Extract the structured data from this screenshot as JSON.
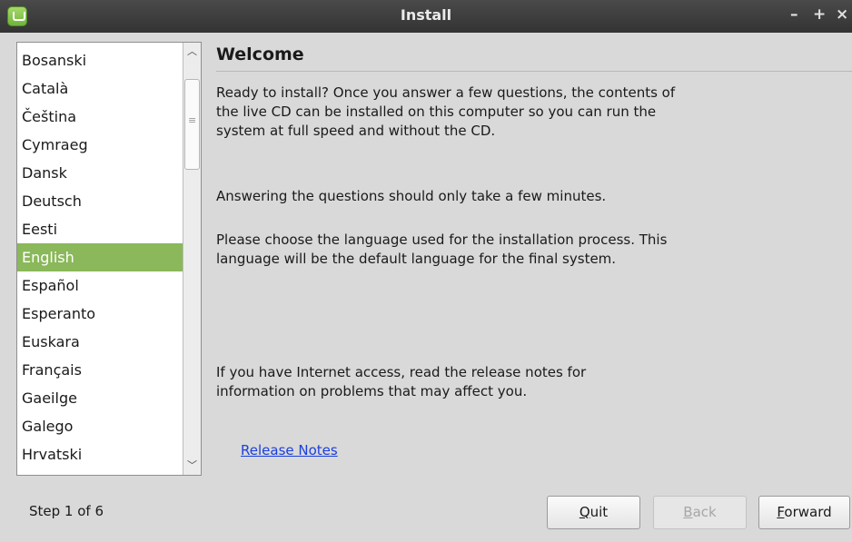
{
  "window": {
    "title": "Install",
    "controls": {
      "minimize": "–",
      "maximize": "+",
      "close": "×"
    }
  },
  "languages": {
    "items": [
      "Bosanski",
      "Català",
      "Čeština",
      "Cymraeg",
      "Dansk",
      "Deutsch",
      "Eesti",
      "English",
      "Español",
      "Esperanto",
      "Euskara",
      "Français",
      "Gaeilge",
      "Galego",
      "Hrvatski"
    ],
    "selected": "English"
  },
  "main": {
    "heading": "Welcome",
    "para1": "Ready to install? Once you answer a few questions, the contents of the live CD can be installed on this computer so you can run the system at full speed and without the CD.",
    "para2": "Answering the questions should only take a few minutes.",
    "para3": "Please choose the language used for the installation process. This language will be the default language for the final system.",
    "para4": "If you have Internet access, read the release notes for information on problems that may affect you.",
    "release_notes_link": "Release Notes"
  },
  "footer": {
    "step": "Step 1 of 6",
    "quit": {
      "mnemonic": "Q",
      "rest": "uit"
    },
    "back": {
      "mnemonic": "B",
      "rest": "ack",
      "enabled": false
    },
    "forward": {
      "mnemonic": "F",
      "rest": "orward"
    }
  },
  "colors": {
    "selection": "#8ab85a",
    "link": "#1a3fdc",
    "titlebar": "#3b3b3b"
  }
}
